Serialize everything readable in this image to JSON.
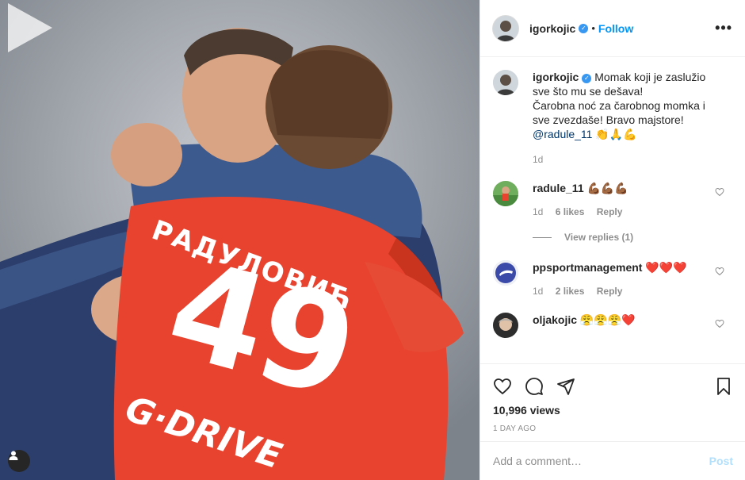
{
  "post": {
    "username": "igorkojic",
    "follow_label": "Follow",
    "dot": "•",
    "more_label": "•••",
    "caption_lines": [
      "Momak koji je zaslužio",
      "sve što mu se dešava!",
      "Čarobna noć za čarobnog momka i",
      "sve zvezdaše! Bravo majstore!",
      "@radule_11 👏🙏💪"
    ],
    "caption_time": "1d",
    "jersey_name": "РАДУЛОВИЋ",
    "jersey_number": "49",
    "sponsor": "G·DRIVE",
    "views": "10,996 views",
    "posted": "1 DAY AGO"
  },
  "comments": [
    {
      "user": "radule_11",
      "text": "💪🏾💪🏾💪🏾",
      "time": "1d",
      "likes": "6 likes",
      "reply": "Reply"
    },
    {
      "user": "ppsportmanagement",
      "text": "❤️❤️❤️",
      "time": "1d",
      "likes": "2 likes",
      "reply": "Reply"
    },
    {
      "user": "oljakojic",
      "text": "😤😤😤❤️"
    }
  ],
  "view_replies": "View replies (1)",
  "add_comment": {
    "placeholder": "Add a comment…",
    "post_label": "Post"
  },
  "icons": [
    "heart-icon",
    "comment-icon",
    "share-icon",
    "bookmark-icon",
    "play-icon",
    "user-icon",
    "verified-icon"
  ],
  "colors": {
    "follow": "#0095f6",
    "post_disabled": "#b2dffc",
    "jersey": "#e8432f"
  }
}
